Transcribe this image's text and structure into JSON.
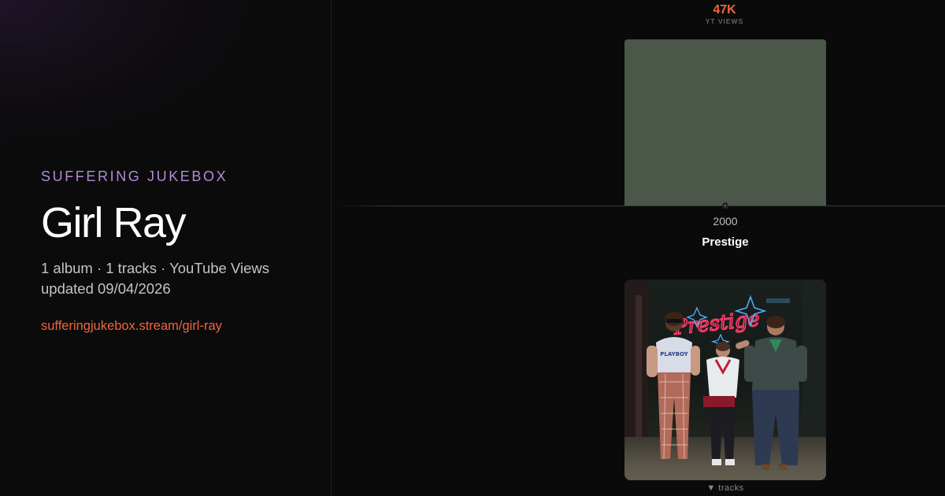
{
  "sidebar": {
    "brand": "SUFFERING JUKEBOX",
    "artist": "Girl Ray",
    "summary": "1 album · 1 tracks · YouTube Views",
    "updated": "updated 09/04/2026",
    "link": "sufferingjukebox.stream/girl-ray"
  },
  "timeline": {
    "stat_value": "47K",
    "stat_label": "YT VIEWS",
    "year": "2000",
    "album_title": "Prestige",
    "cover_text": "Prestige",
    "tracks_toggle": "▼ tracks",
    "bar_fill_fraction": 1.0
  },
  "colors": {
    "accent": "#f0653c",
    "brand": "#b38ad6",
    "bar": "#4a5749",
    "background": "#0a0a0a"
  }
}
